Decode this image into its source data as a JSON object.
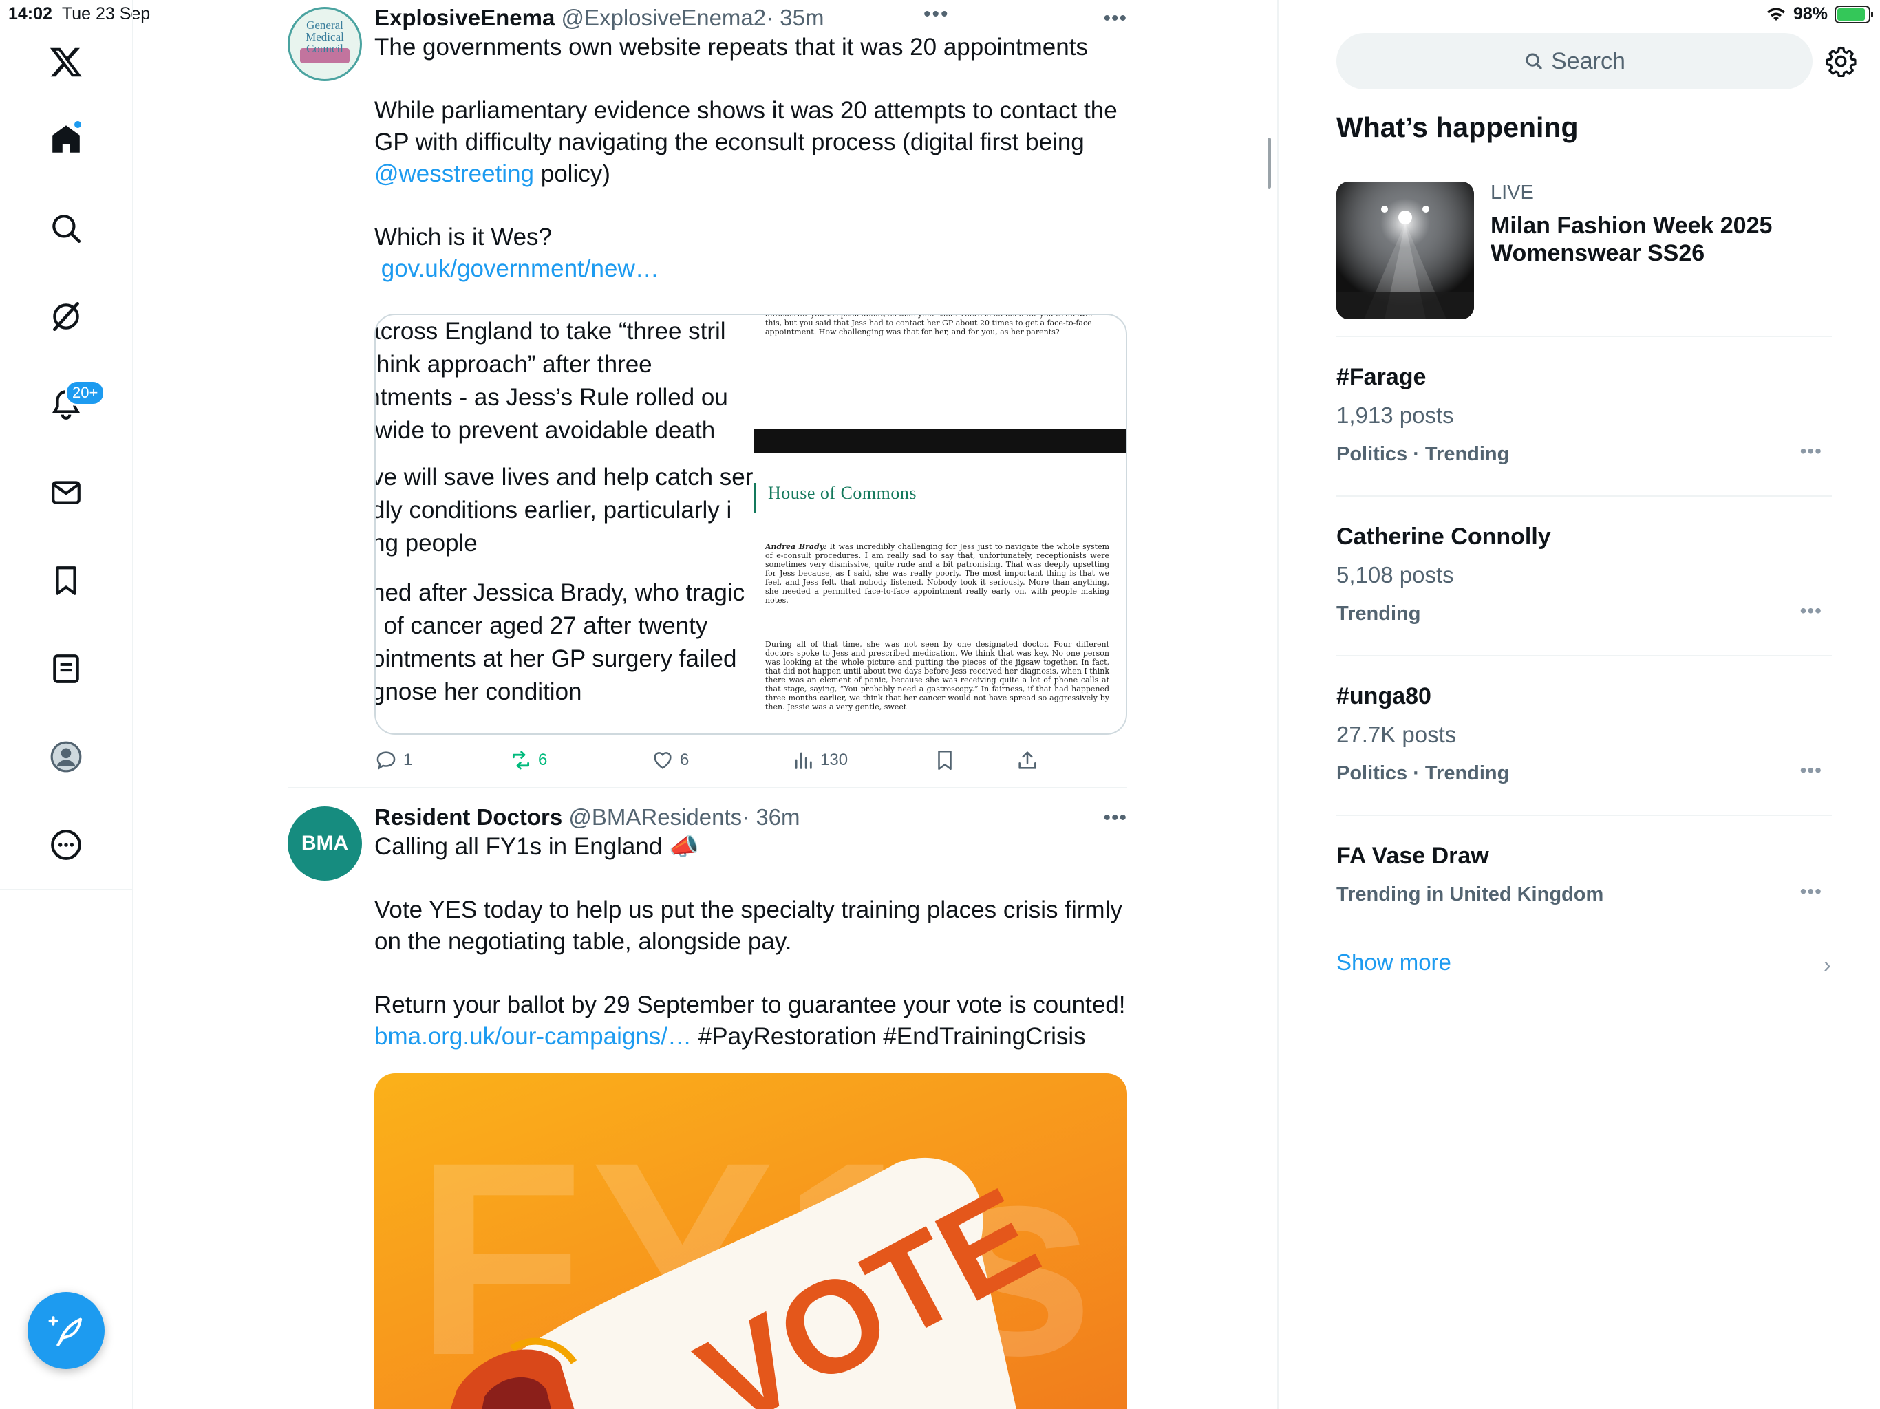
{
  "status_bar": {
    "time": "14:02",
    "date": "Tue 23 Sep",
    "battery": "98%"
  },
  "nav": {
    "items": [
      "X logo",
      "Home",
      "Explore",
      "Grok",
      "Notifications",
      "Messages",
      "Bookmarks",
      "Lists",
      "Profile",
      "More"
    ],
    "notifications_badge": "20+",
    "compose_label": "Post"
  },
  "timeline": {
    "posts": [
      {
        "display_name": "ExplosiveEnema",
        "handle": "@ExplosiveEnema2",
        "time": "· 35m",
        "avatar_text": "General Medical Council",
        "text_lines": [
          "The governments own website repeats that it was 20 appointments",
          "",
          "While parliamentary evidence shows it was 20 attempts to contact the",
          "GP with difficulty navigating the econsult process (digital first being"
        ],
        "mention": "@wesstreeting",
        "after_mention": " policy)",
        "question": "Which is it Wes?",
        "link": "gov.uk/government/new…",
        "media_left": [
          "s across England to take “three stril",
          "rethink approach” after three",
          "ointments - as Jess’s Rule rolled ou",
          "onwide to prevent avoidable death",
          "ve will save lives and help catch ser",
          "dly conditions earlier, particularly i",
          "ng people",
          "ned after Jessica Brady, who tragic",
          "l of cancer aged 27 after twenty",
          "ointments at her GP surgery failed",
          "gnose her condition"
        ],
        "media_right": {
          "top_text": "difficult for you to speak about, so take your time. There is no need for you to answer this, but you said that Jess had to contact her GP about 20 times to get a face-to-face appointment. How challenging was that for her, and for you, as her parents?",
          "house_label": "House of Commons",
          "speaker": "Andrea Brady:",
          "para1": "It was incredibly challenging for Jess just to navigate the whole system of e-consult procedures. I am really sad to say that, unfortunately, receptionists were sometimes very dismissive, quite rude and a bit patronising. That was deeply upsetting for Jess because, as I said, she was really poorly. The most important thing is that we feel, and Jess felt, that nobody listened. Nobody took it seriously. More than anything, she needed a permitted face-to-face appointment really early on, with people making notes.",
          "para2": "During all of that time, she was not seen by one designated doctor. Four different doctors spoke to Jess and prescribed medication. We think that was key. No one person was looking at the whole picture and putting the pieces of the jigsaw together. In fact, that did not happen until about two days before Jess received her diagnosis, when I think there was an element of panic, because she was receiving quite a lot of phone calls at that stage, saying, “You probably need a gastroscopy.” In fairness, if that had happened three months earlier, we think that her cancer would not have spread so aggressively by then. Jessie was a very gentle, sweet"
        },
        "stats": {
          "replies": "1",
          "reposts": "6",
          "likes": "6",
          "views": "130"
        }
      },
      {
        "display_name": "Resident Doctors",
        "handle": "@BMAResidents",
        "time": "· 36m",
        "avatar_text": "BMA",
        "line1": "Calling all FY1s in England 📣",
        "line2": "Vote YES today to help us put the specialty training places crisis firmly",
        "line3": "on the negotiating table, alongside pay.",
        "line4": "Return your ballot by 29 September to guarantee your vote is counted!",
        "link": "bma.org.uk/our-campaigns/…",
        "hashtags": " #PayRestoration #EndTrainingCrisis",
        "image_text_bg": "FY1s",
        "image_text_fg": "VOTE"
      }
    ]
  },
  "sidebar": {
    "search_placeholder": "Search",
    "section_title": "What’s happening",
    "live": {
      "label": "LIVE",
      "title": "Milan Fashion Week 2025 Womenswear SS26"
    },
    "trends": [
      {
        "name": "#Farage",
        "count": "1,913 posts",
        "meta": "Politics · Trending"
      },
      {
        "name": "Catherine Connolly",
        "count": "5,108 posts",
        "meta": "Trending"
      },
      {
        "name": "#unga80",
        "count": "27.7K posts",
        "meta": "Politics · Trending"
      },
      {
        "name": "FA Vase Draw",
        "count": "",
        "meta": "Trending in United Kingdom"
      }
    ],
    "show_more": "Show more"
  },
  "colors": {
    "accent": "#1d9bf0",
    "repost_active": "#00ba7c",
    "text": "#0f1419",
    "muted": "#536471"
  },
  "icons": [
    "x-logo-icon",
    "home-icon",
    "search-icon",
    "grok-icon",
    "bell-icon",
    "mail-icon",
    "bookmark-icon",
    "list-icon",
    "profile-icon",
    "more-icon",
    "compose-icon",
    "settings-icon"
  ]
}
